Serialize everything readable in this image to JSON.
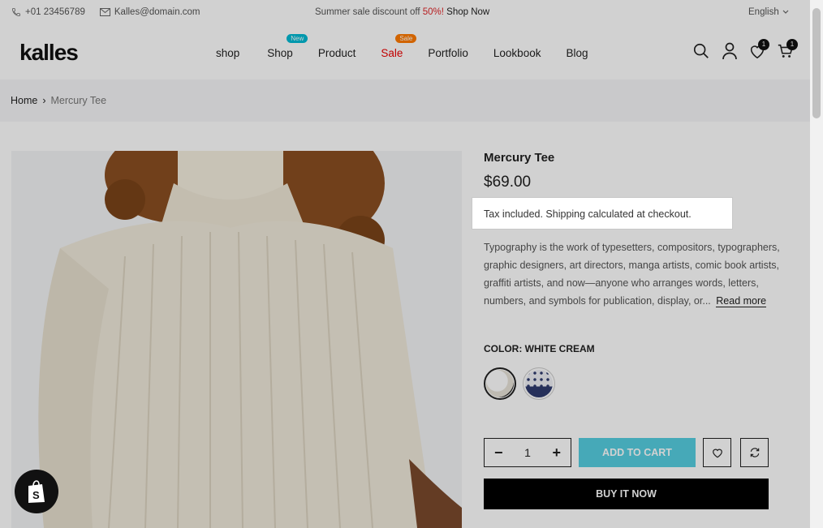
{
  "topbar": {
    "phone": "+01 23456789",
    "email": "Kalles@domain.com",
    "promo_text": "Summer sale discount off",
    "promo_pct": "50%!",
    "promo_link": "Shop Now",
    "language": "English"
  },
  "header": {
    "logo": "kalles",
    "nav": [
      {
        "label": "shop"
      },
      {
        "label": "Shop",
        "badge": "New"
      },
      {
        "label": "Product"
      },
      {
        "label": "Sale",
        "badge": "Sale"
      },
      {
        "label": "Portfolio"
      },
      {
        "label": "Lookbook"
      },
      {
        "label": "Blog"
      }
    ],
    "wishlist_count": "1",
    "cart_count": "1"
  },
  "breadcrumb": {
    "home": "Home",
    "separator": "›",
    "current": "Mercury Tee"
  },
  "product": {
    "title": "Mercury Tee",
    "price": "$69.00",
    "tax_note": "Tax included. Shipping calculated at checkout.",
    "description": "Typography is the work of typesetters, compositors, typographers, graphic designers, art directors, manga artists, comic book artists, graffiti artists, and now—anyone who arranges words, letters, numbers, and symbols for publication, display, or...",
    "read_more": "Read more",
    "color_label": "COLOR: WHITE CREAM",
    "swatches": [
      {
        "name": "White Cream",
        "color": "#efece6"
      },
      {
        "name": "Dotted",
        "color": "#e4e6ee"
      }
    ],
    "quantity": "1",
    "add_to_cart": "ADD TO CART",
    "buy_now": "BUY IT NOW"
  },
  "colors": {
    "accent": "#56cfe1",
    "sale": "#ec0101",
    "new_badge": "#01bad4",
    "sale_badge": "#ff7a00"
  }
}
